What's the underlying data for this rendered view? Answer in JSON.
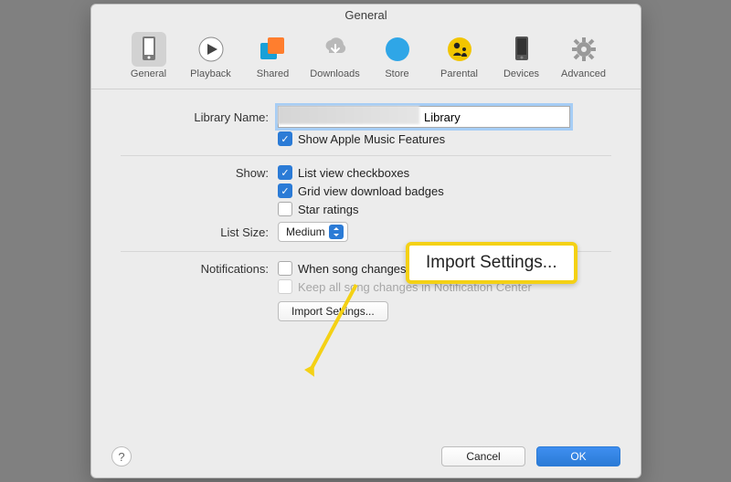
{
  "title": "General",
  "toolbar": [
    {
      "id": "general",
      "label": "General",
      "selected": true
    },
    {
      "id": "playback",
      "label": "Playback"
    },
    {
      "id": "shared",
      "label": "Shared"
    },
    {
      "id": "downloads",
      "label": "Downloads"
    },
    {
      "id": "store",
      "label": "Store"
    },
    {
      "id": "parental",
      "label": "Parental"
    },
    {
      "id": "devices",
      "label": "Devices"
    },
    {
      "id": "advanced",
      "label": "Advanced"
    }
  ],
  "labels": {
    "library_name": "Library Name:",
    "show": "Show:",
    "list_size": "List Size:",
    "notifications": "Notifications:"
  },
  "fields": {
    "library_name_value": "Library",
    "list_size_value": "Medium"
  },
  "checkboxes": {
    "apple_music": {
      "label": "Show Apple Music Features",
      "checked": true
    },
    "list_checkboxes": {
      "label": "List view checkboxes",
      "checked": true
    },
    "grid_badges": {
      "label": "Grid view download badges",
      "checked": true
    },
    "star_ratings": {
      "label": "Star ratings",
      "checked": false
    },
    "song_changes": {
      "label": "When song changes",
      "checked": false
    },
    "keep_notifications": {
      "label": "Keep all song changes in Notification Center",
      "checked": false,
      "disabled": true
    }
  },
  "buttons": {
    "import_settings": "Import Settings...",
    "cancel": "Cancel",
    "ok": "OK"
  },
  "callout": {
    "text": "Import Settings..."
  }
}
